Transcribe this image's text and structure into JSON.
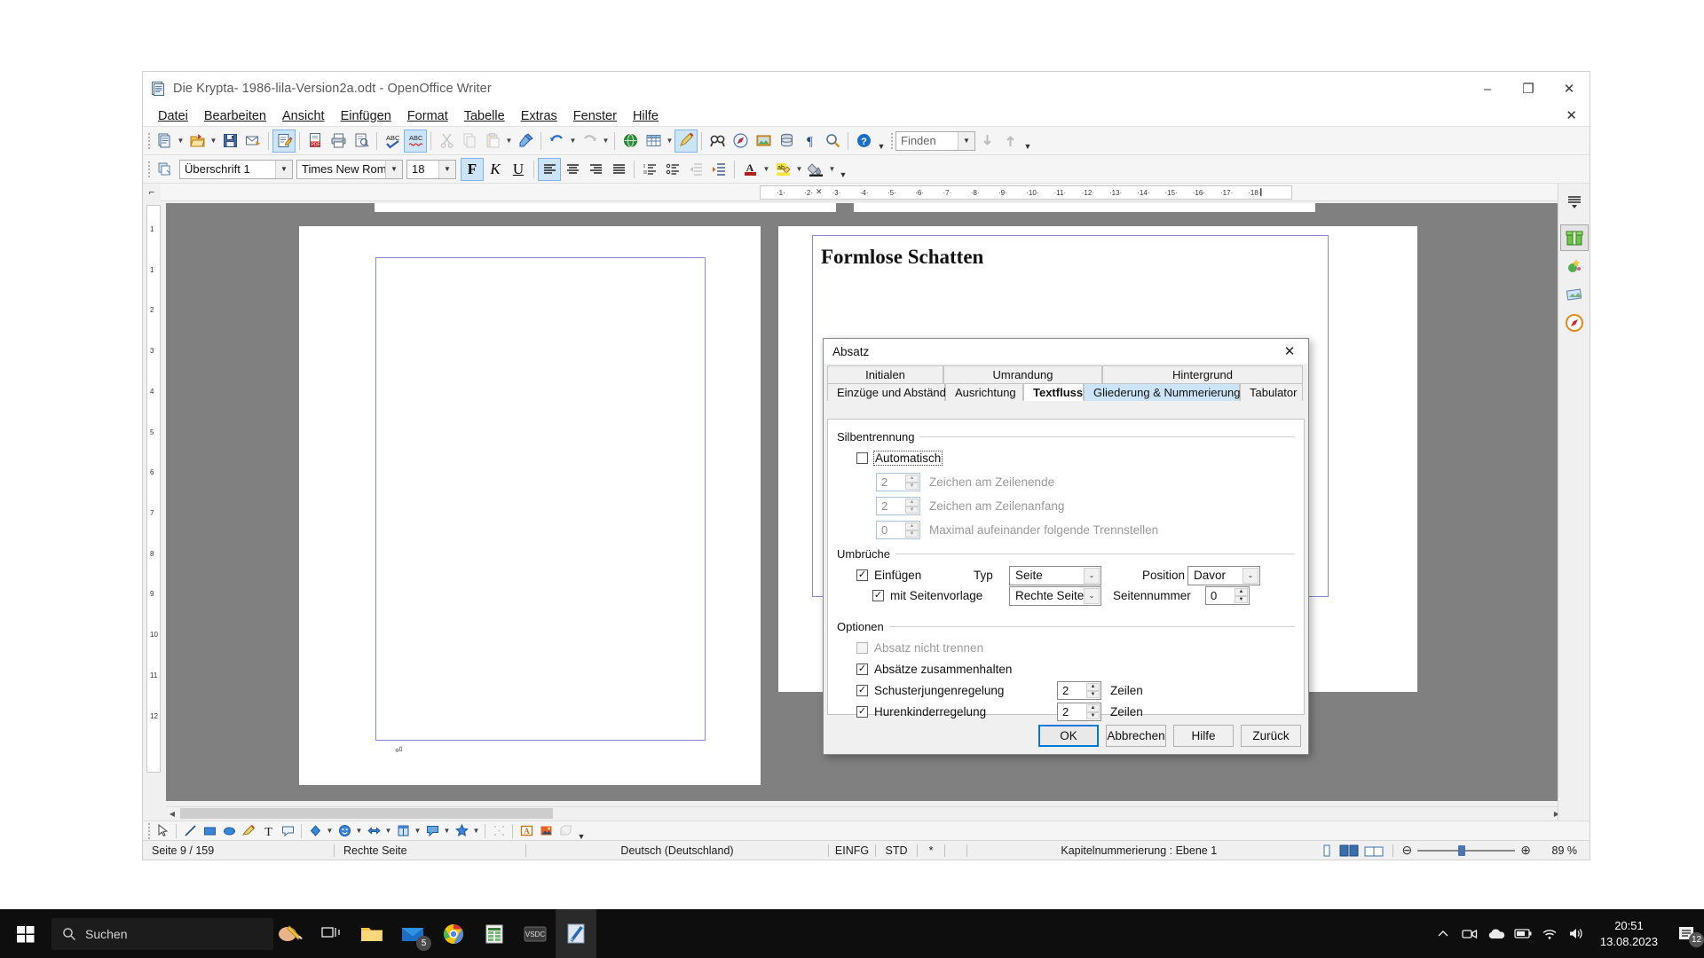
{
  "window": {
    "title": "Die Krypta- 1986-lila-Version2a.odt - OpenOffice Writer",
    "minimize": "–",
    "maximize": "❐",
    "close": "✕"
  },
  "menubar": {
    "close_doc": "✕",
    "items": [
      {
        "label": "Datei"
      },
      {
        "label": "Bearbeiten"
      },
      {
        "label": "Ansicht"
      },
      {
        "label": "Einfügen"
      },
      {
        "label": "Format"
      },
      {
        "label": "Tabelle"
      },
      {
        "label": "Extras"
      },
      {
        "label": "Fenster"
      },
      {
        "label": "Hilfe"
      }
    ]
  },
  "standard_toolbar": {
    "find_placeholder": "Finden",
    "items": [
      {
        "name": "new-document-icon"
      },
      {
        "name": "open-document-icon"
      },
      {
        "name": "save-icon"
      },
      {
        "name": "email-document-icon"
      },
      {
        "name": "edit-file-icon"
      },
      {
        "name": "export-pdf-icon"
      },
      {
        "name": "print-icon"
      },
      {
        "name": "print-preview-icon"
      },
      {
        "name": "spellcheck-icon"
      },
      {
        "name": "autospellcheck-icon"
      },
      {
        "name": "cut-icon"
      },
      {
        "name": "copy-icon"
      },
      {
        "name": "paste-icon"
      },
      {
        "name": "clone-formatting-icon"
      },
      {
        "name": "undo-icon"
      },
      {
        "name": "redo-icon"
      },
      {
        "name": "hyperlink-icon"
      },
      {
        "name": "table-icon"
      },
      {
        "name": "show-draw-functions-icon"
      },
      {
        "name": "find-replace-icon"
      },
      {
        "name": "navigator-icon"
      },
      {
        "name": "gallery-icon"
      },
      {
        "name": "data-sources-icon"
      },
      {
        "name": "formatting-marks-icon"
      },
      {
        "name": "zoom-icon"
      },
      {
        "name": "help-icon"
      }
    ]
  },
  "formatting_toolbar": {
    "paragraph_style": "Überschrift 1",
    "font_name": "Times New Roman",
    "font_size": "18",
    "bold": "F",
    "italic": "K",
    "underline": "U",
    "items": [
      {
        "name": "apply-style-icon"
      },
      {
        "name": "align-left-icon"
      },
      {
        "name": "align-center-icon"
      },
      {
        "name": "align-right-icon"
      },
      {
        "name": "justified-icon"
      },
      {
        "name": "numbering-icon"
      },
      {
        "name": "bullets-icon"
      },
      {
        "name": "decrease-indent-icon"
      },
      {
        "name": "increase-indent-icon"
      },
      {
        "name": "font-color-icon"
      },
      {
        "name": "highlighting-icon"
      },
      {
        "name": "background-color-icon"
      }
    ]
  },
  "document": {
    "heading": "Formlose Schatten",
    "ruler_ticks": [
      "1",
      "2",
      "3",
      "4",
      "5",
      "6",
      "7",
      "8",
      "9",
      "10",
      "11",
      "12",
      "13",
      "14",
      "15",
      "16",
      "17",
      "18"
    ],
    "vruler_ticks": [
      "1",
      "1",
      "2",
      "3",
      "4",
      "5",
      "6",
      "7",
      "8",
      "9",
      "10",
      "11",
      "12"
    ]
  },
  "sidebar": {
    "items": [
      {
        "name": "sidebar-settings-icon",
        "glyph": "☰"
      },
      {
        "name": "sidebar-properties-icon",
        "glyph": "Ἰ1"
      },
      {
        "name": "sidebar-gallery-icon",
        "glyph": "✦"
      },
      {
        "name": "sidebar-styles-icon",
        "glyph": "▣"
      },
      {
        "name": "sidebar-navigator-icon",
        "glyph": "◎"
      }
    ]
  },
  "drawing_toolbar": {
    "items": [
      {
        "name": "select-icon"
      },
      {
        "name": "line-icon"
      },
      {
        "name": "rectangle-icon"
      },
      {
        "name": "ellipse-icon"
      },
      {
        "name": "freeform-line-icon"
      },
      {
        "name": "text-box-icon"
      },
      {
        "name": "callout-icon"
      },
      {
        "name": "basic-shapes-icon"
      },
      {
        "name": "symbol-shapes-icon"
      },
      {
        "name": "block-arrows-icon"
      },
      {
        "name": "flowchart-icon"
      },
      {
        "name": "callouts-icon"
      },
      {
        "name": "stars-icon"
      },
      {
        "name": "points-icon"
      },
      {
        "name": "fontwork-gallery-icon"
      },
      {
        "name": "from-file-icon"
      },
      {
        "name": "extrusion-on-off-icon"
      }
    ]
  },
  "statusbar": {
    "page": "Seite 9 / 159",
    "page_style": "Rechte Seite",
    "language": "Deutsch (Deutschland)",
    "insert_mode": "EINFG",
    "selection_mode": "STD",
    "modified": "*",
    "outline": "Kapitelnummerierung : Ebene 1",
    "zoom_value": "89 %",
    "view_single": "single-page-view-icon",
    "view_multi": "multi-page-view-icon",
    "view_book": "book-view-icon",
    "zoom_out": "⊖",
    "zoom_in": "⊕"
  },
  "dialog": {
    "title": "Absatz",
    "close": "✕",
    "tabs_top": [
      {
        "label": "Initialen",
        "state": "normal"
      },
      {
        "label": "Umrandung",
        "state": "normal"
      },
      {
        "label": "Hintergrund",
        "state": "normal"
      }
    ],
    "tabs_bottom": [
      {
        "label": "Einzüge und Abstände",
        "state": "normal"
      },
      {
        "label": "Ausrichtung",
        "state": "normal"
      },
      {
        "label": "Textfluss",
        "state": "selected"
      },
      {
        "label": "Gliederung & Nummerierung",
        "state": "highlighted"
      },
      {
        "label": "Tabulator",
        "state": "normal"
      }
    ],
    "hyphenation": {
      "group_label": "Silbentrennung",
      "automatic": {
        "label": "Automatisch",
        "checked": false
      },
      "fields": [
        {
          "value": "2",
          "label": "Zeichen am Zeilenende",
          "disabled": true
        },
        {
          "value": "2",
          "label": "Zeichen am Zeilenanfang",
          "disabled": true
        },
        {
          "value": "0",
          "label": "Maximal aufeinander folgende Trennstellen",
          "disabled": true
        }
      ]
    },
    "breaks": {
      "group_label": "Umbrüche",
      "insert": {
        "label": "Einfügen",
        "checked": true
      },
      "type_label": "Typ",
      "type_value": "Seite",
      "position_label": "Position",
      "position_value": "Davor",
      "with_page_style": {
        "label": "mit Seitenvorlage",
        "checked": true
      },
      "page_style_value": "Rechte Seite",
      "page_number_label": "Seitennummer",
      "page_number_value": "0"
    },
    "options": {
      "group_label": "Optionen",
      "do_not_split": {
        "label": "Absatz nicht trennen",
        "checked": false,
        "disabled": true
      },
      "keep_together": {
        "label": "Absätze zusammenhalten",
        "checked": true
      },
      "orphan": {
        "label": "Schusterjungenregelung",
        "checked": true,
        "value": "2",
        "unit": "Zeilen"
      },
      "widow": {
        "label": "Hurenkinderregelung",
        "checked": true,
        "value": "2",
        "unit": "Zeilen"
      }
    },
    "buttons": [
      {
        "label": "OK",
        "default": true
      },
      {
        "label": "Abbrechen",
        "default": false
      },
      {
        "label": "Hilfe",
        "default": false
      },
      {
        "label": "Zurück",
        "default": false
      }
    ]
  },
  "taskbar": {
    "search_placeholder": "Suchen",
    "time": "20:51",
    "date": "13.08.2023",
    "notification_count": "12",
    "apps": [
      {
        "name": "taskview-icon"
      },
      {
        "name": "file-explorer-icon"
      },
      {
        "name": "mail-icon"
      },
      {
        "name": "chrome-icon"
      },
      {
        "name": "excel-icon"
      },
      {
        "name": "vsdc-icon"
      },
      {
        "name": "openoffice-writer-icon"
      }
    ],
    "tray": [
      {
        "name": "show-hidden-icons-icon",
        "glyph": "∧"
      },
      {
        "name": "onedrive-icon"
      },
      {
        "name": "battery-icon"
      },
      {
        "name": "wifi-icon"
      },
      {
        "name": "volume-icon"
      }
    ]
  }
}
